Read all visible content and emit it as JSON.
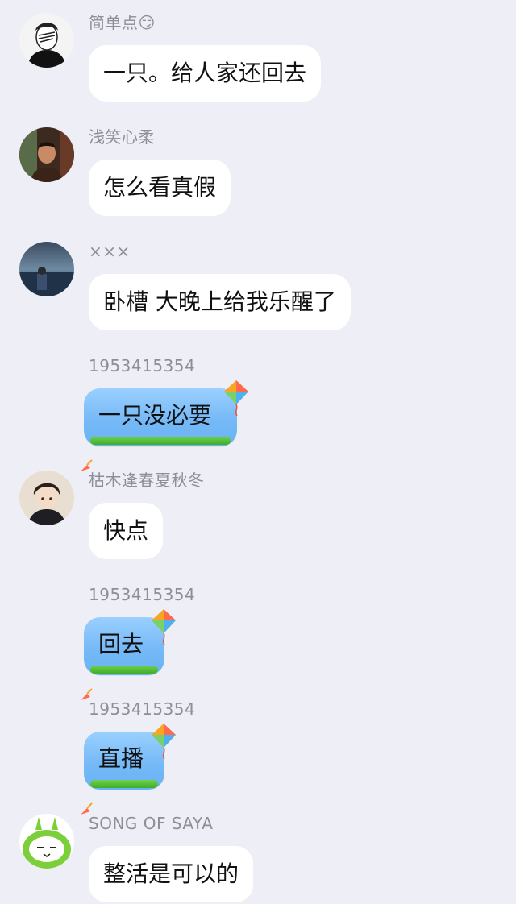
{
  "messages": [
    {
      "name": "简单点😏",
      "text": "一只。给人家还回去",
      "avatar": "avatar-man-covering-face-icon",
      "special": false
    },
    {
      "name": "浅笑心柔",
      "text": "怎么看真假",
      "avatar": "avatar-man-photo-icon",
      "special": false
    },
    {
      "name": "×××",
      "text": "卧槽 大晚上给我乐醒了",
      "avatar": "avatar-seaside-person-icon",
      "special": false
    },
    {
      "name": "1953415354",
      "text": "一只没必要",
      "avatar": "",
      "special": true
    },
    {
      "name": "枯木逢春夏秋冬",
      "text": "快点",
      "avatar": "avatar-anime-boy-icon",
      "special": false
    },
    {
      "name": "1953415354",
      "text": "回去",
      "avatar": "",
      "special": true
    },
    {
      "name": "1953415354",
      "text": "直播",
      "avatar": "",
      "special": true
    },
    {
      "name": "SONG OF SAYA",
      "text": "整活是可以的",
      "avatar": "avatar-green-bunny-icon",
      "special": false
    }
  ],
  "colors": {
    "background": "#eeeef6",
    "bubble": "#ffffff",
    "special_bubble": "#76b9f7",
    "name_text": "#8e8e99"
  }
}
